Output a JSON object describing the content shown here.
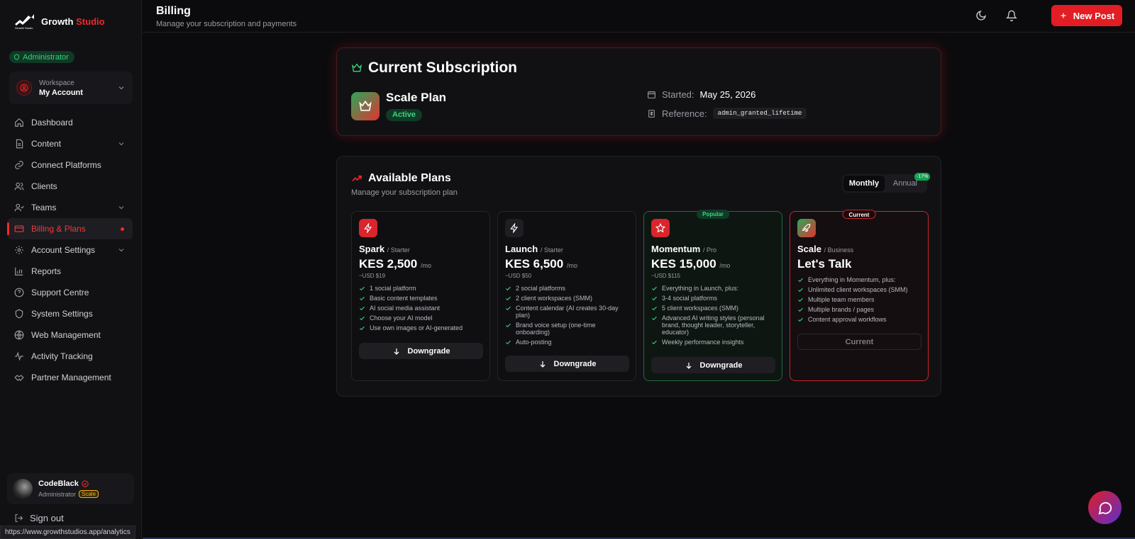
{
  "brand": {
    "name_main": "Growth",
    "name_accent": "Studio",
    "logo_text": "Growth Studio"
  },
  "sidebar": {
    "role_badge": "Administrator",
    "workspace": {
      "label": "Workspace",
      "value": "My Account"
    },
    "items": [
      {
        "label": "Dashboard",
        "icon": "home-icon"
      },
      {
        "label": "Content",
        "icon": "file-icon",
        "expandable": true
      },
      {
        "label": "Connect Platforms",
        "icon": "link-icon"
      },
      {
        "label": "Clients",
        "icon": "users-icon"
      },
      {
        "label": "Teams",
        "icon": "team-icon",
        "expandable": true
      },
      {
        "label": "Billing & Plans",
        "icon": "credit-card-icon",
        "active": true
      },
      {
        "label": "Account Settings",
        "icon": "gear-icon",
        "expandable": true
      },
      {
        "label": "Reports",
        "icon": "bar-chart-icon"
      },
      {
        "label": "Support Centre",
        "icon": "help-circle-icon"
      },
      {
        "label": "System Settings",
        "icon": "shield-icon"
      },
      {
        "label": "Web Management",
        "icon": "globe-icon"
      },
      {
        "label": "Activity Tracking",
        "icon": "activity-icon"
      },
      {
        "label": "Partner Management",
        "icon": "handshake-icon"
      }
    ],
    "user": {
      "name": "CodeBlack",
      "role": "Administrator",
      "plan_chip": "Scale"
    },
    "sign_out": "Sign out",
    "status_url": "https://www.growthstudios.app/analytics"
  },
  "header": {
    "title": "Billing",
    "subtitle": "Manage your subscription and payments",
    "new_post": "New Post"
  },
  "subscription": {
    "title": "Current Subscription",
    "plan_name": "Scale Plan",
    "status": "Active",
    "started_label": "Started:",
    "started_value": "May 25, 2026",
    "reference_label": "Reference:",
    "reference_value": "admin_granted_lifetime"
  },
  "plans": {
    "title": "Available Plans",
    "subtitle": "Manage your subscription plan",
    "toggle": {
      "monthly": "Monthly",
      "annual": "Annual",
      "annual_badge": "-17%",
      "selected": "Monthly"
    },
    "items": [
      {
        "name": "Spark",
        "tier": "/ Starter",
        "price": "KES 2,500",
        "per": "/mo",
        "usd": "~USD $19",
        "features": [
          "1 social platform",
          "Basic content templates",
          "AI social media assistant",
          "Choose your AI model",
          "Use own images or AI-generated"
        ],
        "button": "Downgrade",
        "icon": "lightning-icon"
      },
      {
        "name": "Launch",
        "tier": "/ Starter",
        "price": "KES 6,500",
        "per": "/mo",
        "usd": "~USD $50",
        "features": [
          "2 social platforms",
          "2 client workspaces (SMM)",
          "Content calendar (AI creates 30-day plan)",
          "Brand voice setup (one-time onboarding)",
          "Auto-posting"
        ],
        "button": "Downgrade",
        "icon": "lightning-icon"
      },
      {
        "name": "Momentum",
        "tier": "/ Pro",
        "price": "KES 15,000",
        "per": "/mo",
        "usd": "~USD $115",
        "ribbon": "Popular",
        "features": [
          "Everything in Launch, plus:",
          "3-4 social platforms",
          "5 client workspaces (SMM)",
          "Advanced AI writing styles (personal brand, thought leader, storyteller, educator)",
          "Weekly performance insights"
        ],
        "button": "Downgrade",
        "icon": "star-icon"
      },
      {
        "name": "Scale",
        "tier": "/ Business",
        "price": "Let's Talk",
        "ribbon": "Current",
        "features": [
          "Everything in Momentum, plus:",
          "Unlimited client workspaces (SMM)",
          "Multiple team members",
          "Multiple brands / pages",
          "Content approval workflows"
        ],
        "button": "Current",
        "icon": "rocket-icon"
      }
    ]
  },
  "colors": {
    "accent": "#e21d23",
    "success": "#3ad57e",
    "background": "#0b0b0d",
    "panel": "#111114"
  }
}
